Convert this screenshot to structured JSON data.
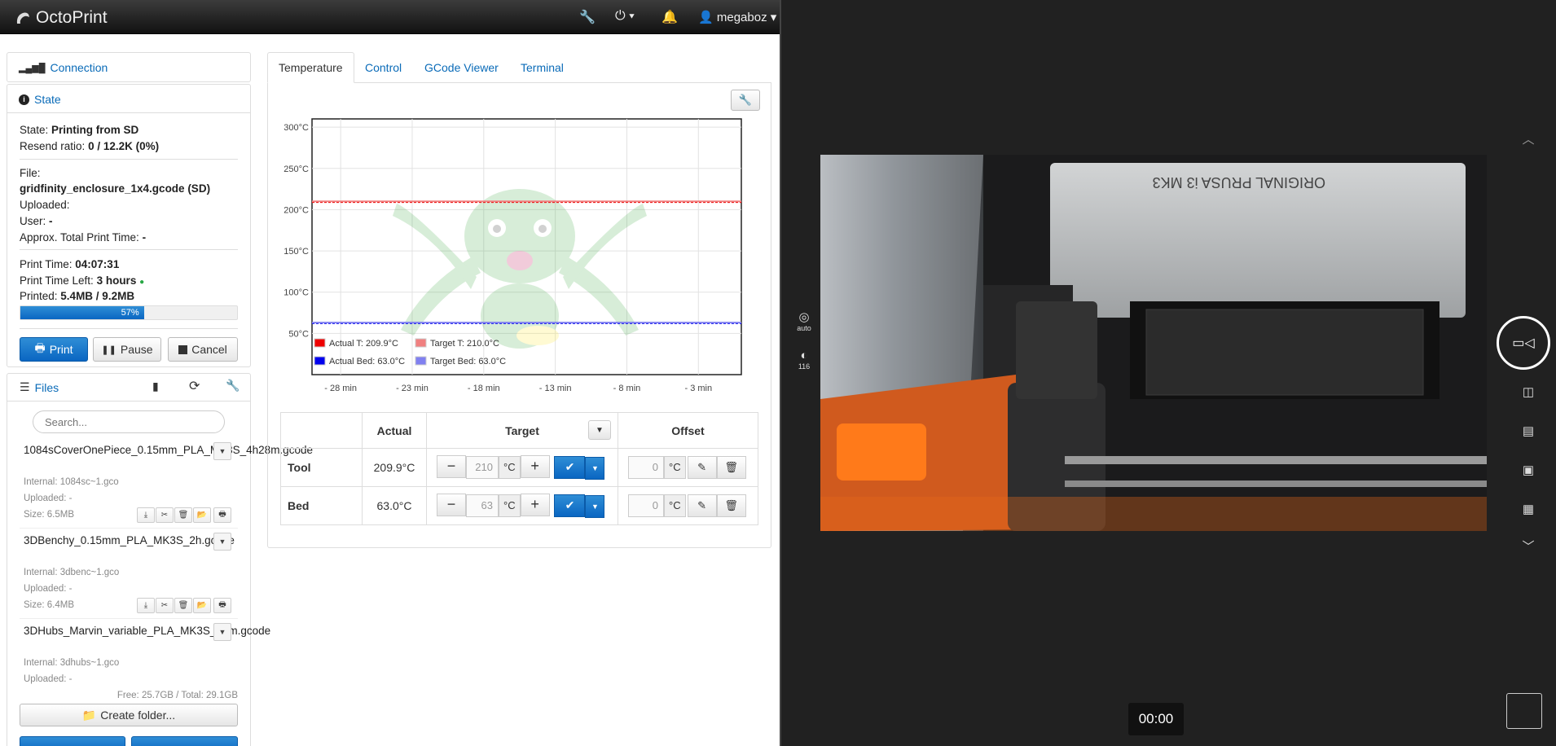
{
  "navbar": {
    "brand": "OctoPrint",
    "user": "megaboz"
  },
  "connection": {
    "title": "Connection"
  },
  "state": {
    "title": "State",
    "state_label": "State:",
    "state_value": "Printing from SD",
    "resend_label": "Resend ratio:",
    "resend_value": "0 / 12.2K (0%)",
    "file_label": "File:",
    "file_value": "gridfinity_enclosure_1x4.gcode (SD)",
    "uploaded_label": "Uploaded:",
    "user_label": "User:",
    "user_value": "-",
    "approx_label": "Approx. Total Print Time:",
    "approx_value": "-",
    "print_time_label": "Print Time:",
    "print_time_value": "04:07:31",
    "time_left_label": "Print Time Left:",
    "time_left_value": "3 hours",
    "printed_label": "Printed:",
    "printed_value": "5.4MB / 9.2MB",
    "progress_percent": 57,
    "progress_text": "57%",
    "buttons": {
      "print": "Print",
      "pause": "Pause",
      "cancel": "Cancel"
    }
  },
  "files": {
    "title": "Files",
    "search_placeholder": "Search...",
    "items": [
      {
        "name": "1084sCoverOnePiece_0.15mm_PLA_MK3S_4h28m.gcode",
        "internal": "Internal: 1084sc~1.gco",
        "uploaded": "Uploaded: -",
        "size": "Size: 6.5MB"
      },
      {
        "name": "3DBenchy_0.15mm_PLA_MK3S_2h.gcode",
        "internal": "Internal: 3dbenc~1.gco",
        "uploaded": "Uploaded: -",
        "size": "Size: 6.4MB"
      },
      {
        "name": "3DHubs_Marvin_variable_PLA_MK3S_52m.gcode",
        "internal": "Internal: 3dhubs~1.gco",
        "uploaded": "Uploaded: -",
        "size": ""
      }
    ],
    "free_total": "Free: 25.7GB / Total: 29.1GB",
    "create_folder": "Create folder..."
  },
  "tabs": [
    {
      "label": "Temperature",
      "active": true
    },
    {
      "label": "Control",
      "active": false
    },
    {
      "label": "GCode Viewer",
      "active": false
    },
    {
      "label": "Terminal",
      "active": false
    }
  ],
  "chart_data": {
    "type": "line",
    "x_ticks": [
      "- 28 min",
      "- 23 min",
      "- 18 min",
      "- 13 min",
      "- 8 min",
      "- 3 min"
    ],
    "y_ticks": [
      "300°C",
      "250°C",
      "200°C",
      "150°C",
      "100°C",
      "50°C"
    ],
    "ylim": [
      0,
      310
    ],
    "xlim": [
      -30,
      0
    ],
    "series": [
      {
        "name": "Actual T: 209.9°C",
        "color": "#ee0000",
        "value": 209.9
      },
      {
        "name": "Target T: 210.0°C",
        "color": "#f08080",
        "value": 210.0
      },
      {
        "name": "Actual Bed: 63.0°C",
        "color": "#0000ee",
        "value": 63.0
      },
      {
        "name": "Target Bed: 63.0°C",
        "color": "#8080f0",
        "value": 63.0
      }
    ],
    "legend_position": "bottom-left"
  },
  "temp_table": {
    "headers": {
      "actual": "Actual",
      "target": "Target",
      "offset": "Offset"
    },
    "rows": [
      {
        "name": "Tool",
        "actual": "209.9°C",
        "target": "210",
        "offset": "0",
        "unit": "°C"
      },
      {
        "name": "Bed",
        "actual": "63.0°C",
        "target": "63",
        "offset": "0",
        "unit": "°C"
      }
    ]
  },
  "camera": {
    "auto_label": "auto",
    "counter": "116",
    "timer": "00:00",
    "overlay_text": "ORIGINAL PRUSA i3 MK3"
  }
}
